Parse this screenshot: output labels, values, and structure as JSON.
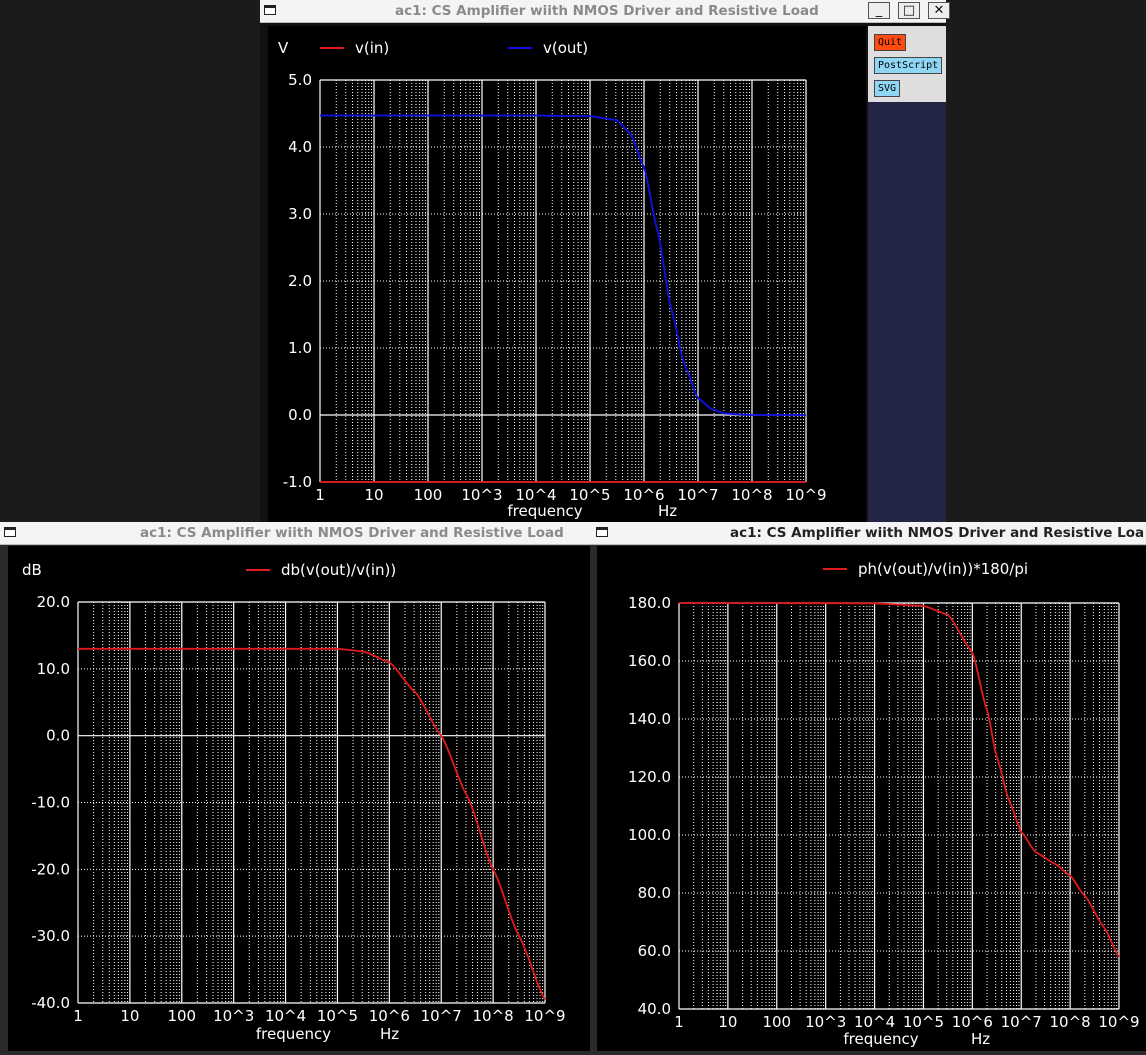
{
  "windows": {
    "top": {
      "title": "ac1: CS Amplifier wiith NMOS Driver and Resistive Load",
      "controls": {
        "minimize": "_",
        "maximize": "□",
        "close": "✕"
      },
      "buttons": {
        "quit": "Quit",
        "postscript": "PostScript",
        "svg": "SVG"
      }
    },
    "bottom_left": {
      "title": "ac1: CS Amplifier wiith NMOS Driver and Resistive Load"
    },
    "bottom_right": {
      "title": "ac1: CS Amplifier wiith NMOS Driver and Resistive Loa"
    }
  },
  "colors": {
    "plot_bg": "#000000",
    "grid": "#ffffff",
    "red_trace": "#e31a1c",
    "blue_trace": "#1010e8",
    "quit_btn": "#ff4a10",
    "action_btn": "#8fd6f5"
  },
  "chart_data": [
    {
      "type": "line",
      "xscale": "log",
      "ylabel": "V",
      "xlabel": "frequency",
      "xunit": "Hz",
      "x_tick_labels": [
        "1",
        "10",
        "100",
        "10^3",
        "10^4",
        "10^5",
        "10^6",
        "10^7",
        "10^8",
        "10^9"
      ],
      "y_tick_labels": [
        "5.0",
        "4.0",
        "3.0",
        "2.0",
        "1.0",
        "0.0",
        "-1.0"
      ],
      "ylim": [
        -1,
        5
      ],
      "xlim": [
        1,
        1000000000
      ],
      "grid": true,
      "series": [
        {
          "name": "v(in)",
          "color": "#e31a1c",
          "x": [
            1,
            1000000000
          ],
          "y": [
            -1.0,
            -1.0
          ]
        },
        {
          "name": "v(out)",
          "color": "#1010e8",
          "x": [
            1,
            10000,
            100000,
            316000,
            562000,
            1000000,
            1780000,
            3160000,
            5620000,
            10000000,
            17800000,
            31600000,
            100000000,
            1000000000
          ],
          "y": [
            4.47,
            4.47,
            4.46,
            4.4,
            4.2,
            3.7,
            2.75,
            1.6,
            0.75,
            0.25,
            0.09,
            0.02,
            0.0,
            0.0
          ]
        }
      ]
    },
    {
      "type": "line",
      "xscale": "log",
      "ylabel": "dB",
      "xlabel": "frequency",
      "xunit": "Hz",
      "x_tick_labels": [
        "1",
        "10",
        "100",
        "10^3",
        "10^4",
        "10^5",
        "10^6",
        "10^7",
        "10^8",
        "10^9"
      ],
      "y_tick_labels": [
        "20.0",
        "10.0",
        "0.0",
        "-10.0",
        "-20.0",
        "-30.0",
        "-40.0"
      ],
      "ylim": [
        -40,
        20
      ],
      "xlim": [
        1,
        1000000000
      ],
      "grid": true,
      "series": [
        {
          "name": "db(v(out)/v(in))",
          "color": "#e31a1c",
          "x": [
            1,
            10000,
            100000,
            316000,
            1000000,
            3160000,
            10000000,
            31600000,
            100000000,
            316000000,
            1000000000
          ],
          "y": [
            13.0,
            13.0,
            13.0,
            12.6,
            11.0,
            6.5,
            0.0,
            -9.0,
            -20.0,
            -30.0,
            -39.5
          ]
        }
      ]
    },
    {
      "type": "line",
      "xscale": "log",
      "xlabel": "frequency",
      "xunit": "Hz",
      "x_tick_labels": [
        "1",
        "10",
        "100",
        "10^3",
        "10^4",
        "10^5",
        "10^6",
        "10^7",
        "10^8",
        "10^9"
      ],
      "y_tick_labels": [
        "180.0",
        "160.0",
        "140.0",
        "120.0",
        "100.0",
        "80.0",
        "60.0",
        "40.0"
      ],
      "ylim": [
        40,
        180
      ],
      "xlim": [
        1,
        1000000000
      ],
      "grid": true,
      "series": [
        {
          "name": "ph(v(out)/v(in))*180/pi",
          "color": "#e31a1c",
          "x": [
            1,
            10000,
            100000,
            316000,
            1000000,
            2000000,
            3160000,
            5620000,
            10000000,
            20000000,
            50000000,
            100000000,
            200000000,
            500000000,
            1000000000
          ],
          "y": [
            180,
            179.9,
            179,
            176,
            163,
            143,
            127,
            112,
            101,
            94,
            90,
            86,
            79,
            68,
            58
          ]
        }
      ]
    }
  ]
}
